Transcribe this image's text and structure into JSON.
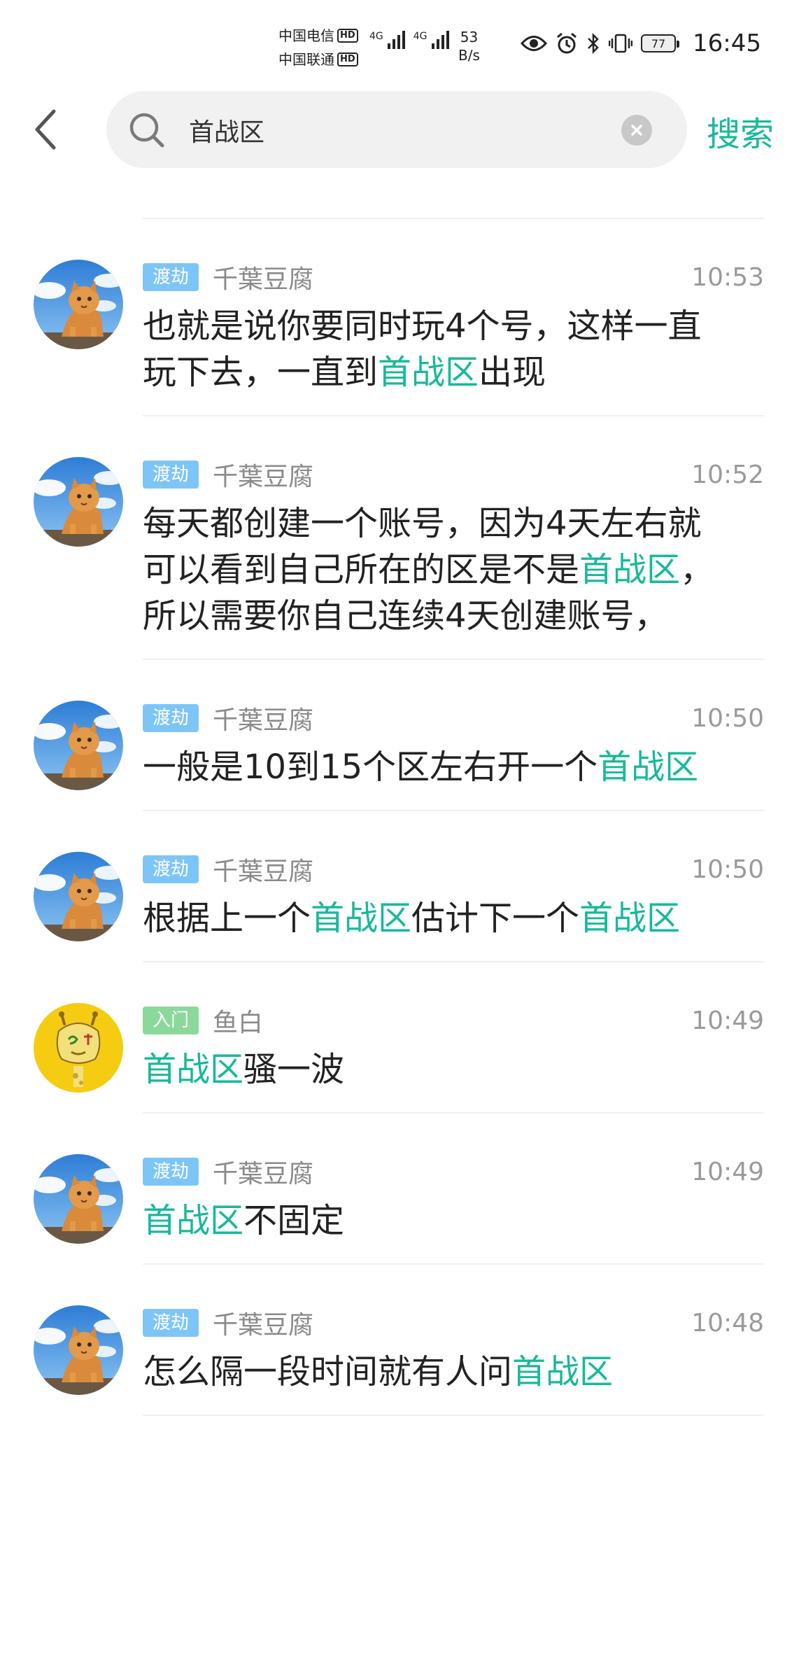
{
  "status_bar": {
    "carrier1": "中国电信",
    "carrier2": "中国联通",
    "hd_label": "HD",
    "net_type": "4G",
    "net_speed_value": "53",
    "net_speed_unit": "B/s",
    "battery": "77",
    "time": "16:45"
  },
  "search": {
    "query": "首战区",
    "action_label": "搜索"
  },
  "colors": {
    "accent": "#17b99a",
    "badge_blue": "#7ec5f7",
    "badge_green": "#8ad99b"
  },
  "messages": [
    {
      "badge": "渡劫",
      "user": "千葉豆腐",
      "time": "10:53",
      "parts": [
        "也就是说你要同时玩4个号，这样一直玩下去，一直到",
        "首战区",
        "出现"
      ]
    },
    {
      "badge": "渡劫",
      "user": "千葉豆腐",
      "time": "10:52",
      "parts": [
        "每天都创建一个账号，因为4天左右就可以看到自己所在的区是不是",
        "首战区",
        "，所以需要你自己连续4天创建账号，"
      ]
    },
    {
      "badge": "渡劫",
      "user": "千葉豆腐",
      "time": "10:50",
      "parts": [
        "一般是10到15个区左右开一个",
        "首战区"
      ]
    },
    {
      "badge": "渡劫",
      "user": "千葉豆腐",
      "time": "10:50",
      "parts": [
        "根据上一个",
        "首战区",
        "估计下一个",
        "首战区"
      ]
    },
    {
      "badge": "入门",
      "user": "鱼白",
      "time": "10:49",
      "parts": [
        "首战区",
        "骚一波"
      ]
    },
    {
      "badge": "渡劫",
      "user": "千葉豆腐",
      "time": "10:49",
      "parts": [
        "首战区",
        "不固定"
      ]
    },
    {
      "badge": "渡劫",
      "user": "千葉豆腐",
      "time": "10:48",
      "parts": [
        "怎么隔一段时间就有人问",
        "首战区"
      ]
    }
  ]
}
